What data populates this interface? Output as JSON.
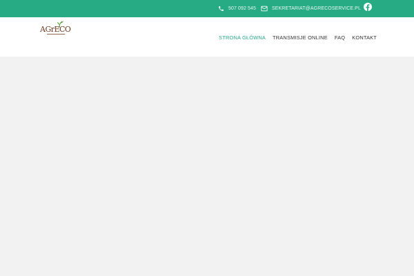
{
  "topbar": {
    "phone": "507 092 545",
    "email": "SEKRETARIAT@AGRECOSERVICE.PL",
    "social": "facebook-icon",
    "background": "#26ab85"
  },
  "logo": {
    "text": "AGrECO"
  },
  "nav": {
    "items": [
      {
        "label": "STRONA GŁÓWNA",
        "active": true
      },
      {
        "label": "TRANSMISJE ONLINE",
        "active": false
      },
      {
        "label": "FAQ",
        "active": false
      },
      {
        "label": "KONTAKT",
        "active": false
      }
    ],
    "active_color": "#26ab85"
  }
}
